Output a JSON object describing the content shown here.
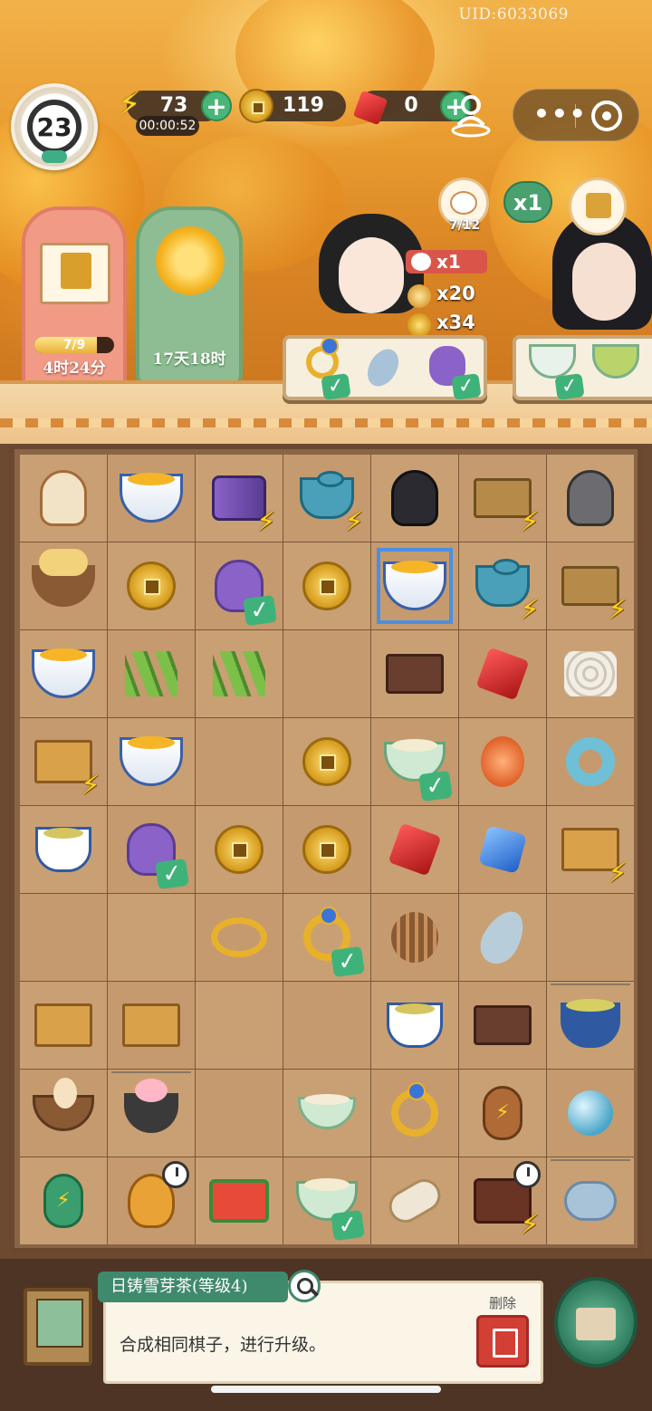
{
  "header": {
    "uid": "UID:6033069",
    "level": "23",
    "energy": "73",
    "energy_timer": "00:00:52",
    "coins": "119",
    "gems": "0"
  },
  "events": {
    "book": {
      "progress": "7/9",
      "progress_fraction": 0.78,
      "time_left": "4时24分"
    },
    "flower": {
      "time_left": "17天18时"
    }
  },
  "customer": {
    "cat_count": "7/12",
    "multiplier": "x1",
    "order": {
      "cats": "x1",
      "items": "x20",
      "coins": "x34"
    }
  },
  "board": {
    "rows": [
      [
        {
          "icon": "cat-calico-icon"
        },
        {
          "icon": "chrysanthemum-bowl-icon"
        },
        {
          "icon": "purple-spool-icon",
          "badge": "energy"
        },
        {
          "icon": "teapot-icon",
          "badge": "energy"
        },
        {
          "icon": "black-cat-icon"
        },
        {
          "icon": "fruit-basket-icon",
          "badge": "energy"
        },
        {
          "icon": "tabby-cat-icon"
        }
      ],
      [
        {
          "icon": "chick-nest-icon"
        },
        {
          "icon": "coin-stack-icon"
        },
        {
          "icon": "purple-pouch-icon",
          "badge": "check"
        },
        {
          "icon": "coin-icon"
        },
        {
          "icon": "chrysanthemum-bowl-icon",
          "selected": true
        },
        {
          "icon": "teapot-set-icon",
          "badge": "energy"
        },
        {
          "icon": "herb-basket-icon",
          "badge": "energy"
        }
      ],
      [
        {
          "icon": "chrysanthemum-bowl-icon"
        },
        {
          "icon": "bamboo-icon"
        },
        {
          "icon": "bamboo-shoot-icon"
        },
        {
          "icon": "empty"
        },
        {
          "icon": "tray-box-icon"
        },
        {
          "icon": "red-gem-icon"
        },
        {
          "icon": "silk-cocoon-icon"
        }
      ],
      [
        {
          "icon": "fabric-crate-icon",
          "badge": "energy"
        },
        {
          "icon": "tea-bowl-icon"
        },
        {
          "icon": "empty"
        },
        {
          "icon": "coin-icon"
        },
        {
          "icon": "soup-bowl-icon",
          "badge": "check"
        },
        {
          "icon": "lantern-icon"
        },
        {
          "icon": "jade-ring-icon"
        }
      ],
      [
        {
          "icon": "tea-cup-icon"
        },
        {
          "icon": "purple-pouch-icon",
          "badge": "check"
        },
        {
          "icon": "coin-icon"
        },
        {
          "icon": "coin-icon"
        },
        {
          "icon": "red-gem-icon"
        },
        {
          "icon": "blue-gem-icon"
        },
        {
          "icon": "tool-crate-icon",
          "badge": "energy"
        }
      ],
      [
        {
          "icon": "empty"
        },
        {
          "icon": "empty"
        },
        {
          "icon": "bracelet-icon"
        },
        {
          "icon": "gold-ring-icon",
          "badge": "check"
        },
        {
          "icon": "wicker-ball-icon"
        },
        {
          "icon": "feather-icon"
        },
        {
          "icon": "empty"
        }
      ],
      [
        {
          "icon": "tool-crate-icon"
        },
        {
          "icon": "tea-crate-icon"
        },
        {
          "icon": "empty"
        },
        {
          "icon": "empty"
        },
        {
          "icon": "tea-cup-icon"
        },
        {
          "icon": "wooden-box-icon"
        },
        {
          "icon": "green-tea-bowl-icon",
          "web": true
        }
      ],
      [
        {
          "icon": "egg-nest-icon"
        },
        {
          "icon": "peach-bun-icon",
          "web": true
        },
        {
          "icon": "empty"
        },
        {
          "icon": "plain-bowl-icon"
        },
        {
          "icon": "gold-ring-icon"
        },
        {
          "icon": "energy-gourd-brown-icon"
        },
        {
          "icon": "blue-bead-icon"
        }
      ],
      [
        {
          "icon": "energy-gourd-icon"
        },
        {
          "icon": "hen-nest-icon",
          "badge": "clock"
        },
        {
          "icon": "watermelon-tray-icon"
        },
        {
          "icon": "soup-bowl-icon",
          "badge": "check"
        },
        {
          "icon": "spindle-icon"
        },
        {
          "icon": "treasure-chest-icon",
          "badge": "energy",
          "badge2": "clock"
        },
        {
          "icon": "blue-sachet-icon",
          "web": true
        }
      ]
    ]
  },
  "info": {
    "item_name": "日铸雪芽茶(等级4)",
    "description": "合成相同棋子，进行升级。",
    "delete_label": "删除"
  }
}
